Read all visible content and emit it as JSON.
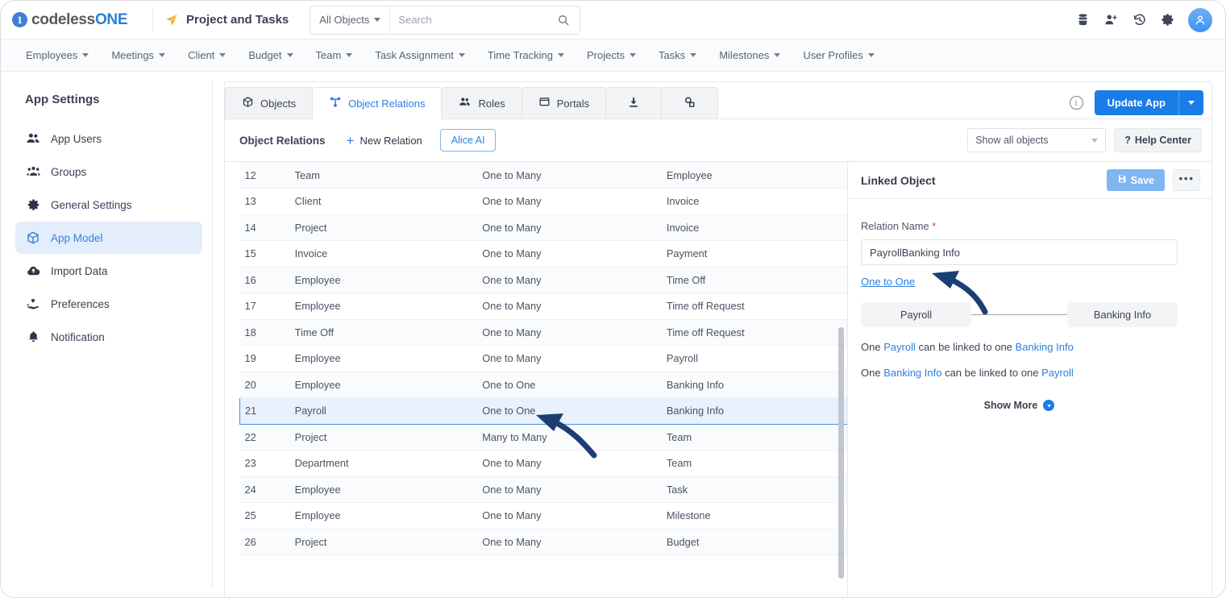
{
  "brand": {
    "name_part1": "codeless",
    "name_part2": "ONE",
    "mark": "1"
  },
  "header": {
    "app_title": "Project and Tasks",
    "scope_selector": "All Objects",
    "search_placeholder": "Search",
    "search_value": "",
    "icons": [
      "database-icon",
      "add-user-icon",
      "history-icon",
      "gear-icon",
      "avatar"
    ]
  },
  "menubar": {
    "items": [
      {
        "label": "Employees"
      },
      {
        "label": "Meetings"
      },
      {
        "label": "Client"
      },
      {
        "label": "Budget"
      },
      {
        "label": "Team"
      },
      {
        "label": "Task Assignment"
      },
      {
        "label": "Time Tracking"
      },
      {
        "label": "Projects"
      },
      {
        "label": "Tasks"
      },
      {
        "label": "Milestones"
      },
      {
        "label": "User Profiles"
      }
    ]
  },
  "sidebar": {
    "title": "App Settings",
    "items": [
      {
        "label": "App Users",
        "icon": "users-icon",
        "active": false
      },
      {
        "label": "Groups",
        "icon": "groups-icon",
        "active": false
      },
      {
        "label": "General Settings",
        "icon": "gear-icon",
        "active": false
      },
      {
        "label": "App Model",
        "icon": "cube-icon",
        "active": true
      },
      {
        "label": "Import Data",
        "icon": "cloud-upload-icon",
        "active": false
      },
      {
        "label": "Preferences",
        "icon": "hand-heart-icon",
        "active": false
      },
      {
        "label": "Notification",
        "icon": "bell-icon",
        "active": false
      }
    ]
  },
  "tabs": [
    {
      "label": "Objects",
      "icon": "cube-icon",
      "active": false
    },
    {
      "label": "Object Relations",
      "icon": "relations-icon",
      "active": true
    },
    {
      "label": "Roles",
      "icon": "users-icon",
      "active": false
    },
    {
      "label": "Portals",
      "icon": "window-icon",
      "active": false
    },
    {
      "label": "",
      "icon": "download-icon",
      "active": false
    },
    {
      "label": "",
      "icon": "shapes-icon",
      "active": false
    }
  ],
  "tab_actions": {
    "info_icon": "info-icon",
    "update_app_label": "Update App"
  },
  "subtoolbar": {
    "title": "Object Relations",
    "new_relation_label": "New Relation",
    "alice_ai_label": "Alice AI",
    "filter_value": "Show all objects",
    "help_center_label": "Help Center"
  },
  "table": {
    "rows": [
      {
        "id": "12",
        "from": "Team",
        "relation": "One to Many",
        "to": "Employee"
      },
      {
        "id": "13",
        "from": "Client",
        "relation": "One to Many",
        "to": "Invoice"
      },
      {
        "id": "14",
        "from": "Project",
        "relation": "One to Many",
        "to": "Invoice"
      },
      {
        "id": "15",
        "from": "Invoice",
        "relation": "One to Many",
        "to": "Payment"
      },
      {
        "id": "16",
        "from": "Employee",
        "relation": "One to Many",
        "to": "Time Off"
      },
      {
        "id": "17",
        "from": "Employee",
        "relation": "One to Many",
        "to": "Time off Request"
      },
      {
        "id": "18",
        "from": "Time Off",
        "relation": "One to Many",
        "to": "Time off Request"
      },
      {
        "id": "19",
        "from": "Employee",
        "relation": "One to Many",
        "to": "Payroll"
      },
      {
        "id": "20",
        "from": "Employee",
        "relation": "One to One",
        "to": "Banking Info"
      },
      {
        "id": "21",
        "from": "Payroll",
        "relation": "One to One",
        "to": "Banking Info"
      },
      {
        "id": "22",
        "from": "Project",
        "relation": "Many to Many",
        "to": "Team"
      },
      {
        "id": "23",
        "from": "Department",
        "relation": "One to Many",
        "to": "Team"
      },
      {
        "id": "24",
        "from": "Employee",
        "relation": "One to Many",
        "to": "Task"
      },
      {
        "id": "25",
        "from": "Employee",
        "relation": "One to Many",
        "to": "Milestone"
      },
      {
        "id": "26",
        "from": "Project",
        "relation": "One to Many",
        "to": "Budget"
      }
    ],
    "selected_row_id": "21"
  },
  "right_panel": {
    "title": "Linked Object",
    "save_label": "Save",
    "more_label": "•••",
    "relation_name_label": "Relation Name",
    "relation_name_value": "PayrollBanking Info",
    "relation_type_link": "One to One",
    "diagram": {
      "left_box": "Payroll",
      "right_box": "Banking Info"
    },
    "sentence1": {
      "pre": "One ",
      "a": "Payroll",
      "mid": " can be linked to one ",
      "b": "Banking Info"
    },
    "sentence2": {
      "pre": "One ",
      "a": "Banking Info",
      "mid": " can be linked to one ",
      "b": "Payroll"
    },
    "show_more_label": "Show More"
  },
  "colors": {
    "accent": "#1a7ce8",
    "link": "#2b7fe0",
    "selected_row_bg": "#e8f1fd",
    "selected_row_border": "#4e90de",
    "sidebar_active_bg": "#e3edfb",
    "annotation_arrow": "#1b3f73"
  }
}
